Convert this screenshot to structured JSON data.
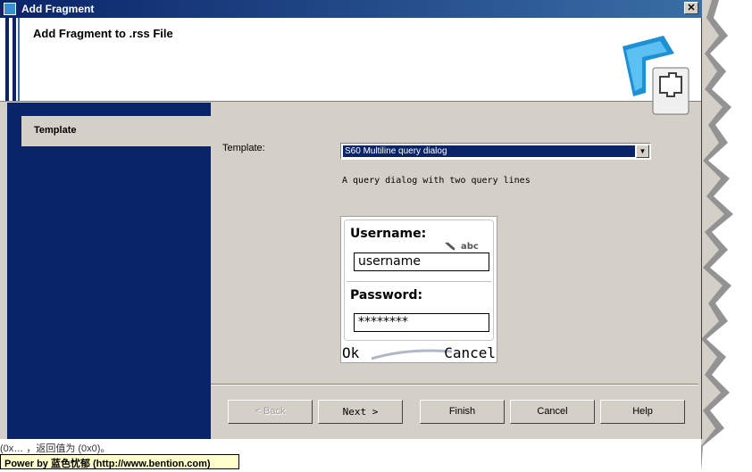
{
  "window": {
    "title": "Add Fragment",
    "close_label": "✕"
  },
  "header": {
    "heading": "Add Fragment to .rss File"
  },
  "sidebar": {
    "items": [
      {
        "label": "Template"
      }
    ]
  },
  "form": {
    "template_label": "Template:",
    "template_value": "S60 Multiline query dialog",
    "description": "A query dialog with two query lines"
  },
  "preview": {
    "username_label": "Username:",
    "input_mode": "abc",
    "username_value": "username",
    "password_label": "Password:",
    "password_value": "********",
    "left_softkey": "Ok",
    "right_softkey": "Cancel"
  },
  "buttons": {
    "back": "< Back",
    "next": "Next >",
    "finish": "Finish",
    "cancel": "Cancel",
    "help": "Help"
  },
  "background_text": "(0x…    ，返回值为  (0x0)。",
  "watermark": "Power by 蓝色忧郁 (http://www.bention.com)",
  "colors": {
    "accent": "#0a246a",
    "face": "#d4d0c8"
  }
}
